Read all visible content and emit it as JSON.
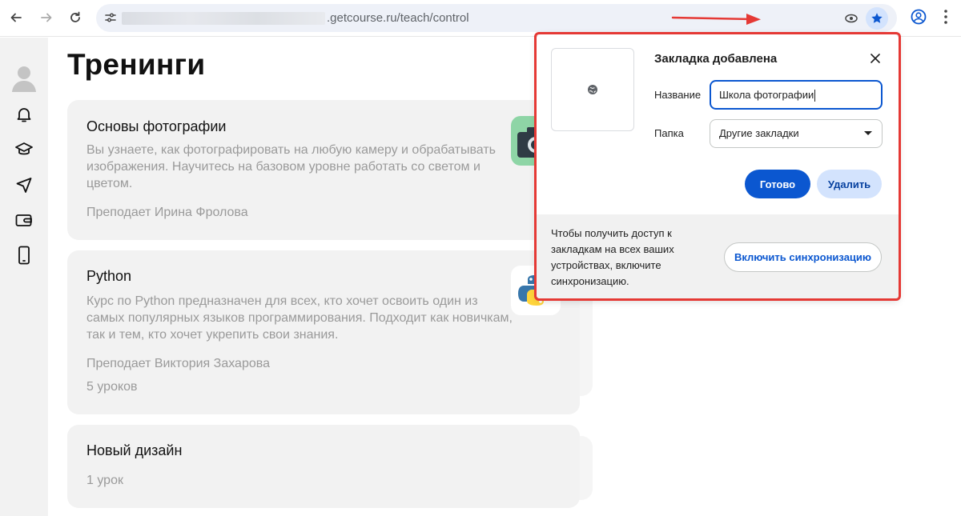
{
  "browser": {
    "url_visible": ".getcourse.ru/teach/control"
  },
  "page": {
    "title": "Тренинги"
  },
  "courses": [
    {
      "title": "Основы фотографии",
      "description": "Вы узнаете, как фотографировать на любую камеру и обрабатывать изображения. Научитесь на базовом уровне работать со светом и цветом.",
      "teacher": "Преподает Ирина Фролова"
    },
    {
      "title": "Python",
      "description": "Курс по Python предназначен для всех, кто хочет освоить один из самых популярных языков программирования. Подходит как новичкам, так и тем, кто хочет укрепить свои знания.",
      "teacher": "Преподает Виктория Захарова",
      "lessons": "5 уроков"
    },
    {
      "title": "Новый дизайн",
      "lessons": "1 урок"
    }
  ],
  "bookmark_popup": {
    "title": "Закладка добавлена",
    "name_label": "Название",
    "name_value": "Школа фотографии",
    "folder_label": "Папка",
    "folder_value": "Другие закладки",
    "done_label": "Готово",
    "remove_label": "Удалить",
    "sync_text": "Чтобы получить доступ к закладкам на всех ваших устройствах, включите синхронизацию.",
    "sync_button": "Включить синхронизацию"
  },
  "colors": {
    "accent_blue": "#0b57d0",
    "annotation_red": "#e53935"
  }
}
